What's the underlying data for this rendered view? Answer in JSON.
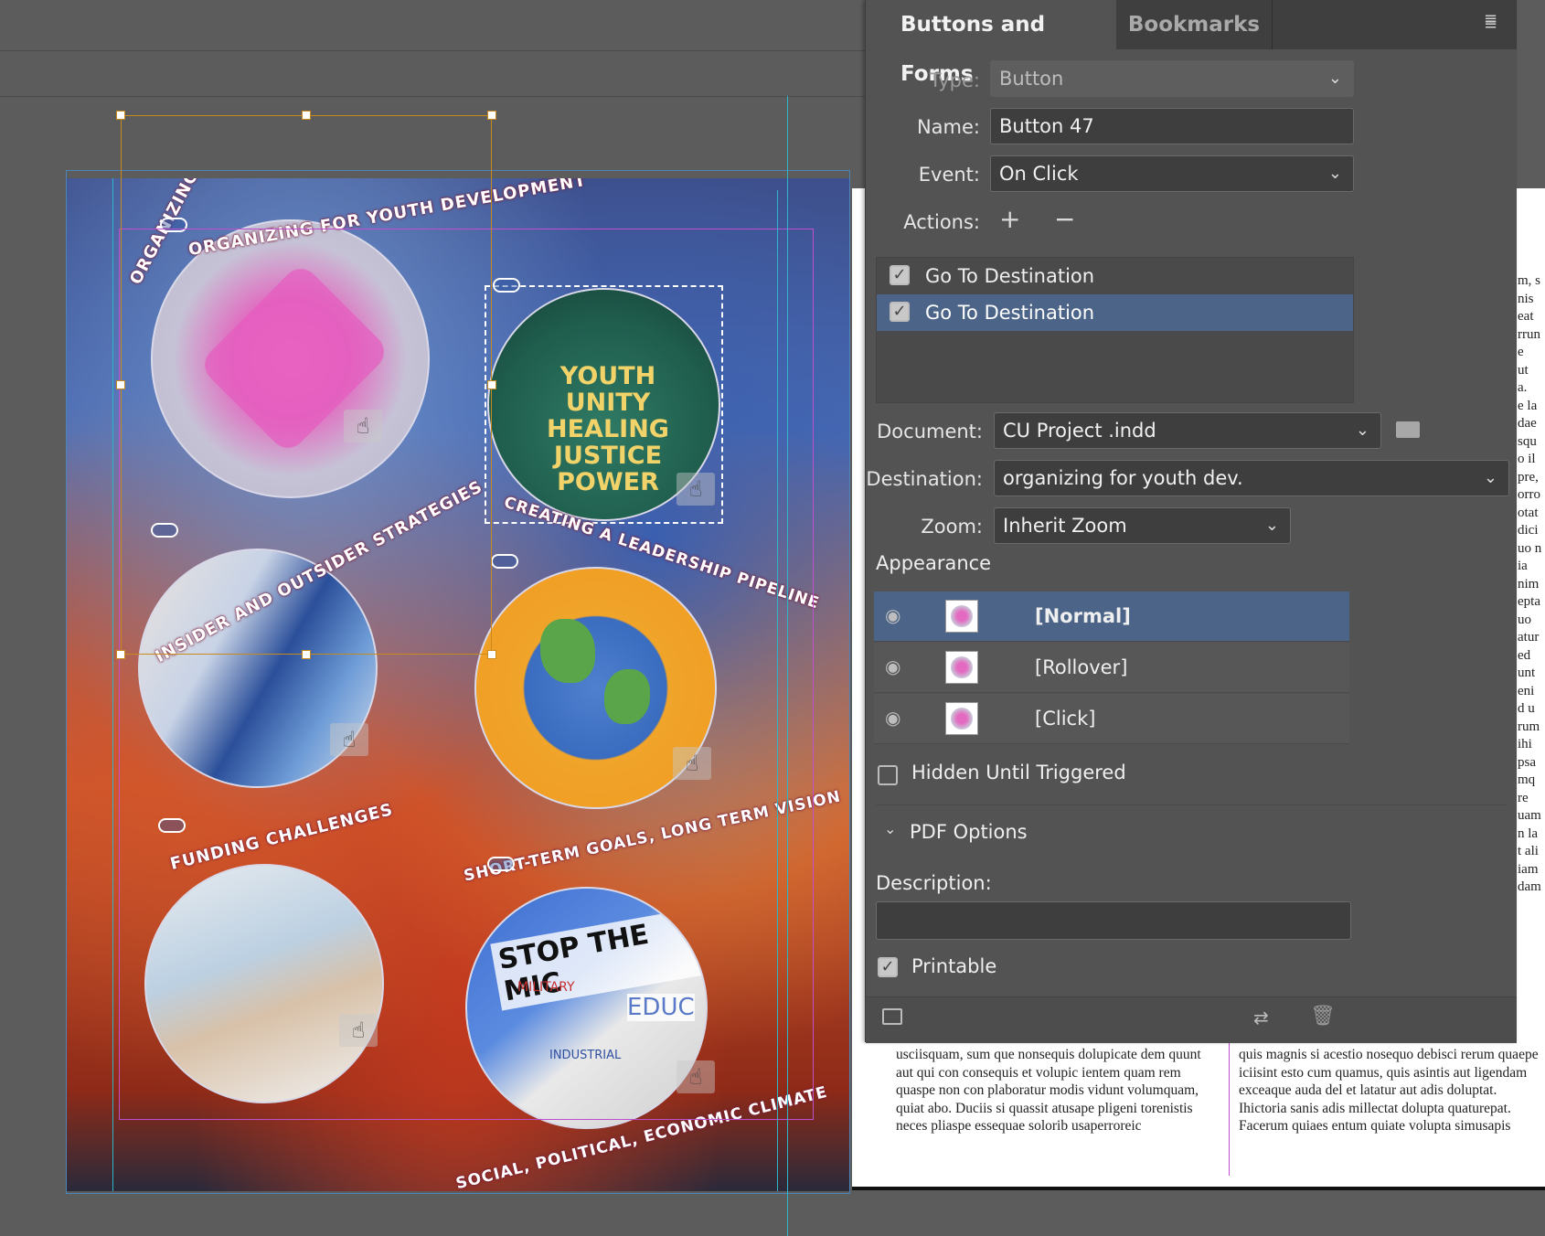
{
  "panel": {
    "tabs": [
      "Buttons and Forms",
      "Bookmarks"
    ],
    "type_label": "Type:",
    "type_value": "Button",
    "name_label": "Name:",
    "name_value": "Button 47",
    "event_label": "Event:",
    "event_value": "On Click",
    "actions_label": "Actions:",
    "actions": [
      "Go To Destination",
      "Go To Destination"
    ],
    "document_label": "Document:",
    "document_value": "CU Project .indd",
    "destination_label": "Destination:",
    "destination_value": "organizing for youth dev.",
    "zoom_label": "Zoom:",
    "zoom_value": "Inherit Zoom",
    "appearance_title": "Appearance",
    "appearance_states": [
      "[Normal]",
      "[Rollover]",
      "[Click]"
    ],
    "hidden_label": "Hidden Until Triggered",
    "pdf_options_label": "PDF Options",
    "description_label": "Description:",
    "printable_label": "Printable"
  },
  "artwork": {
    "ring1": "ORGANIZING FOR YOUTH DEVELOPMENT",
    "ring2": "CREATING A LEADERSHIP PIPELINE",
    "ring3": "INSIDER AND OUTSIDER STRATEGIES",
    "ring4": "SHORT-TERM GOALS, LONG TERM VISION",
    "ring5": "FUNDING CHALLENGES",
    "ring6": "SOCIAL, POLITICAL, ECONOMIC CLIMATE",
    "shirt_lines": [
      "YOUTH",
      "UNITY",
      "HEALING",
      "JUSTICE",
      "POWER"
    ],
    "sign_text": "STOP THE MIC",
    "sign_sub1": "MILITARY",
    "sign_sub2": "INDUSTRIAL",
    "sign2": "EDUC"
  },
  "doc_text": {
    "right_fragments": [
      "m, s",
      "nis",
      "eat",
      "rrun",
      "e",
      "ut",
      "a.",
      "e la",
      "dae",
      "squ",
      "o il",
      "pre,",
      "orro",
      "otat",
      "dici",
      "uo n",
      "ia",
      "nim",
      "epta",
      "uo",
      "atur",
      "ed",
      "unt",
      "eni",
      "d u",
      "rum",
      "ihi",
      "psa",
      "mq",
      "re",
      "uam",
      "n la",
      "t ali",
      "iam",
      "dam"
    ],
    "col1": "usciisquam, sum que nonsequis dolupicate dem quunt aut qui con consequis et volupic ientem quam rem quaspe non con plaboratur modis vidunt volumquam, quiat abo. Duciis si quassit atusape pligeni torenistis neces pliaspe essequae solorib usaperroreic",
    "col2": "quis magnis si acestio nosequo debisci rerum quaepe iciisint esto cum quamus, quis asintis aut ligendam exceaque auda del et latatur aut adis doluptat. Ihictoria sanis adis millectat dolupta quaturepat. Facerum quiaes entum quiate volupta simusapis"
  },
  "colors": {
    "panel_bg": "#535353",
    "selection": "#4b6487",
    "frame_orange": "#c88a1a",
    "guide_cyan": "#2fb5c8",
    "margin_magenta": "#c04fd0"
  }
}
